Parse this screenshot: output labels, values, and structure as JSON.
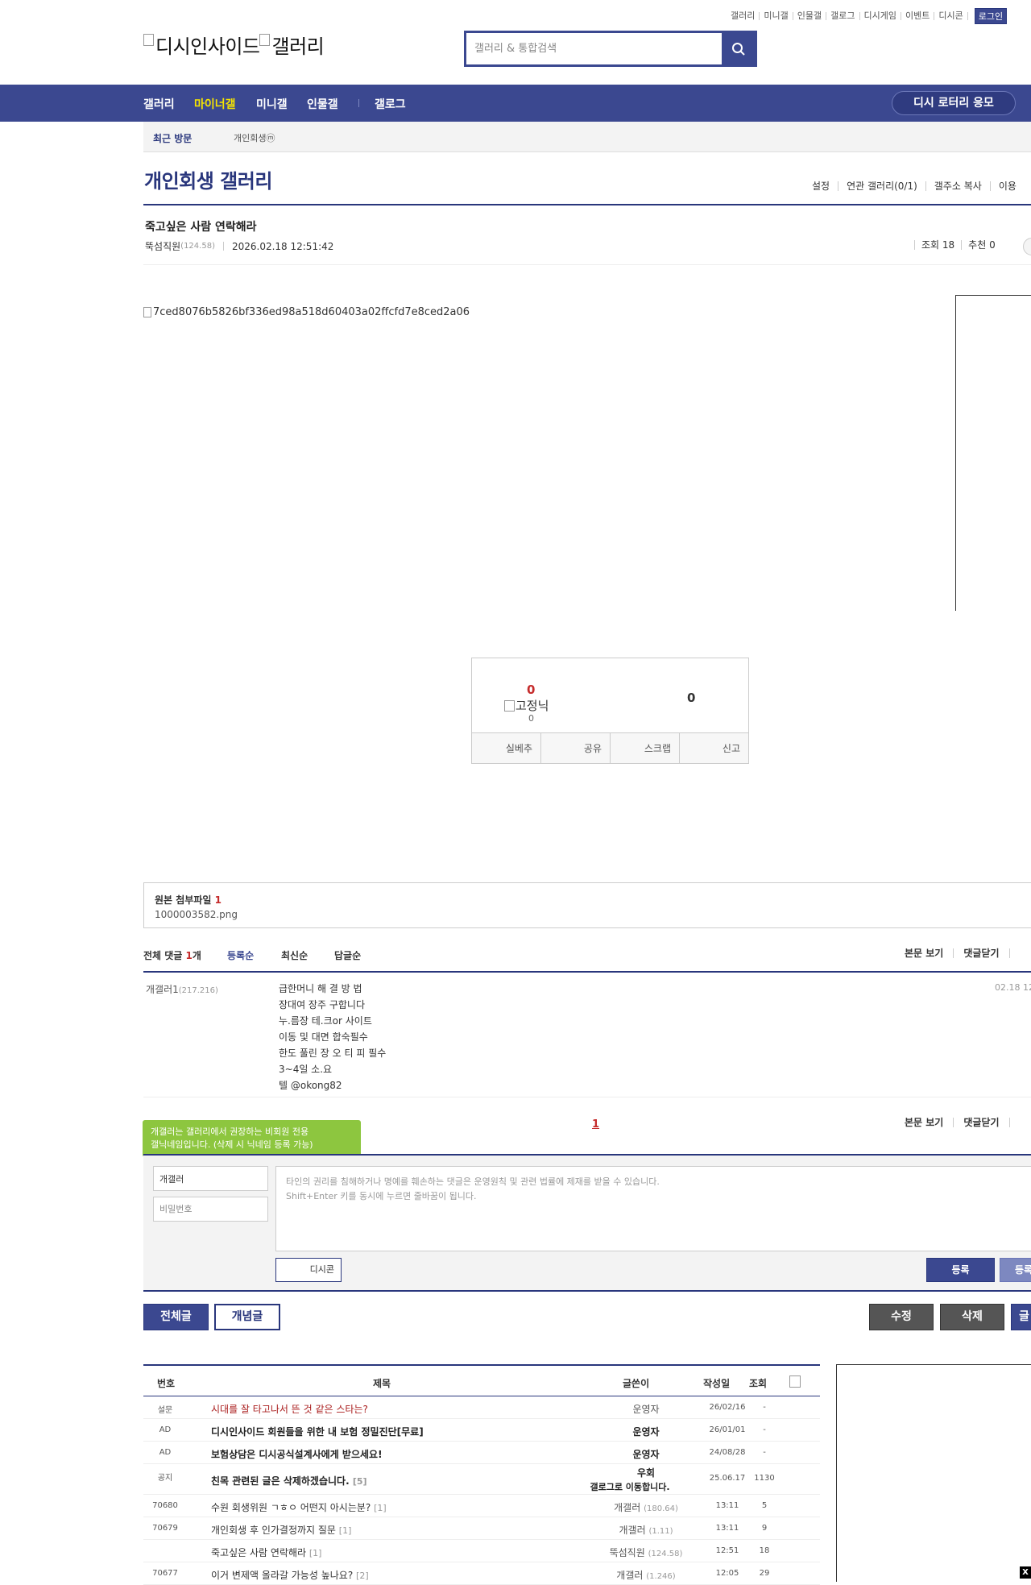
{
  "top_links": {
    "items": [
      "갤러리",
      "미니갤",
      "인물갤",
      "갤로그",
      "디시게임",
      "이벤트",
      "디시콘"
    ],
    "login": "로그인"
  },
  "logo": {
    "alt1": "디시인사이드",
    "alt2": "갤러리"
  },
  "search": {
    "placeholder": "갤러리 & 통합검색"
  },
  "gnb": {
    "items": [
      "갤러리",
      "마이너갤",
      "미니갤",
      "인물갤",
      "갤로그"
    ],
    "active_index": 1,
    "lottery": "디시 로터리 응모"
  },
  "visit": {
    "title": "최근 방문",
    "item": "개인회생ⓜ"
  },
  "gallery": {
    "title": "개인회생 갤러리",
    "menu": [
      "설정",
      "연관 갤러리(0/1)",
      "갤주소 복사",
      "이용"
    ]
  },
  "post": {
    "title": "죽고싶은 사람 연락해라",
    "writer": "뚝섬직원",
    "writer_ip": "(124.58)",
    "date": "2026.02.18 12:51:42",
    "views": "조회 18",
    "recommends": "추천 0",
    "image_alt": "7ced8076b5826bf336ed98a518d60403a02ffcfd7e8ced2a06"
  },
  "recommend": {
    "up_count": "0",
    "fix_alt": "고정닉",
    "fix_count": "0",
    "down_count": "0",
    "actions": [
      "실베추",
      "공유",
      "스크랩",
      "신고"
    ]
  },
  "attach": {
    "title": "원본 첨부파일",
    "count": "1",
    "file": "1000003582.png"
  },
  "comments": {
    "total_label": "전체 댓글",
    "total_count": "1",
    "total_unit": "개",
    "sort": [
      "등록순",
      "최신순",
      "답글순"
    ],
    "right_links": [
      "본문 보기",
      "댓글닫기"
    ],
    "items": [
      {
        "writer": "개갤러1",
        "ip": "(217.216)",
        "lines": [
          "급한머니 해 결 방 법",
          "장대여 장주 구합니다",
          "누.름장 테.크or 사이트",
          "이동 및 대면 합숙필수",
          "한도 풀린 장 오 티 피 필수",
          "3~4일 소.요",
          "텔 @okong82"
        ],
        "date": "02.18 12"
      }
    ],
    "page": "1"
  },
  "tooltip": {
    "line1": "개갤러는 갤러리에서 권장하는 비회원 전용",
    "line2": "갤닉네임입니다. (삭제 시 닉네임 등록 가능)"
  },
  "form": {
    "nick_value": "개갤러",
    "pw_placeholder": "비밀번호",
    "text_placeholder": "타인의 권리를 침해하거나 명예를 훼손하는 댓글은 운영원칙 및 관련 법률에 제재를 받을 수 있습니다.\nShift+Enter 키를 동시에 누르면 줄바꿈이 됩니다.",
    "dccon": "디시콘",
    "register": "등록",
    "register2": "등록"
  },
  "buttons": {
    "all": "전체글",
    "best": "개념글",
    "edit": "수정",
    "delete": "삭제",
    "write": "글"
  },
  "list": {
    "headers": [
      "번호",
      "제목",
      "글쓴이",
      "작성일",
      "조회"
    ],
    "rows": [
      {
        "no": "설문",
        "title": "시대를 잘 타고나서 뜬 것 같은 스타는?",
        "reply": "",
        "writer": "운영자",
        "ip": "",
        "date": "26/02/16",
        "views": "-",
        "type": "survey"
      },
      {
        "no": "AD",
        "title": "디시인사이드 회원들을 위한 내 보험 정밀진단[무료]",
        "reply": "",
        "writer": "운영자",
        "ip": "",
        "date": "26/01/01",
        "views": "-",
        "type": "notice"
      },
      {
        "no": "AD",
        "title": "보험상담은 디시공식설계사에게 받으세요!",
        "reply": "",
        "writer": "운영자",
        "ip": "",
        "date": "24/08/28",
        "views": "-",
        "type": "notice"
      },
      {
        "no": "공지",
        "title": "친목 관련된 글은 삭제하겠습니다.",
        "reply": "[5]",
        "writer": "우회",
        "ip": "",
        "date": "25.06.17",
        "views": "1130",
        "type": "notice",
        "writer_sub": "갤로그로 이동합니다."
      },
      {
        "no": "70680",
        "title": "수원 회생위원 ㄱㅎㅇ 어떤지 아시는분?",
        "reply": "[1]",
        "writer": "개갤러",
        "ip": "(180.64)",
        "date": "13:11",
        "views": "5",
        "type": ""
      },
      {
        "no": "70679",
        "title": "개인회생 후 인가결정까지 질문",
        "reply": "[1]",
        "writer": "개갤러",
        "ip": "(1.11)",
        "date": "13:11",
        "views": "9",
        "type": ""
      },
      {
        "no": "",
        "title": "죽고싶은 사람 연락해라",
        "reply": "[1]",
        "writer": "뚝섬직원",
        "ip": "(124.58)",
        "date": "12:51",
        "views": "18",
        "type": ""
      },
      {
        "no": "70677",
        "title": "이거 변제액 올라갈 가능성 높나요?",
        "reply": "[2]",
        "writer": "개갤러",
        "ip": "(1.246)",
        "date": "12:05",
        "views": "29",
        "type": ""
      }
    ]
  },
  "close_label": "X",
  "colors": {
    "brand": "#3b4890",
    "brand_dark": "#29367c",
    "accent_red": "#c52b2b",
    "tooltip_green": "#8dc63f"
  }
}
